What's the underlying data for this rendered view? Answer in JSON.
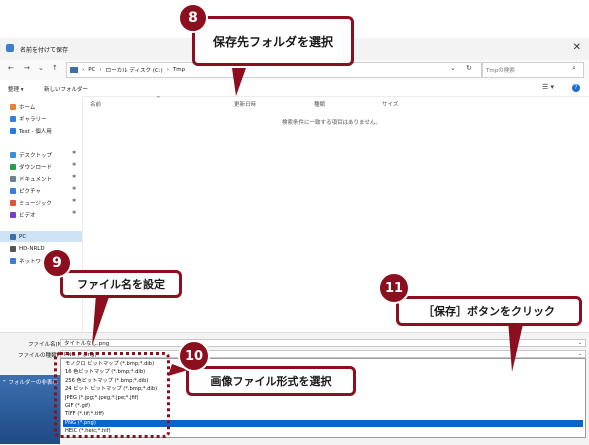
{
  "window": {
    "title": "名前を付けて保存"
  },
  "address": {
    "segments": [
      "PC",
      "ローカル ディスク (C:)",
      "Tmp"
    ],
    "search_placeholder": "Tmpの検索"
  },
  "toolbar": {
    "organize": "整理 ▾",
    "new_folder": "新しいフォルダー"
  },
  "sidebar": {
    "items": [
      {
        "label": "ホーム",
        "color": "#e5823a",
        "pinned": false
      },
      {
        "label": "ギャラリー",
        "color": "#3b7fd1",
        "pinned": false
      },
      {
        "label": "Test - 個人用",
        "color": "#2d7ad6",
        "pinned": false
      },
      {
        "label": "デスクトップ",
        "color": "#3b8fd8",
        "pinned": true
      },
      {
        "label": "ダウンロード",
        "color": "#2e9a4d",
        "pinned": true
      },
      {
        "label": "ドキュメント",
        "color": "#6b7f95",
        "pinned": true
      },
      {
        "label": "ピクチャ",
        "color": "#3a7fcf",
        "pinned": true
      },
      {
        "label": "ミュージック",
        "color": "#d8543a",
        "pinned": true
      },
      {
        "label": "ビデオ",
        "color": "#7a3fc4",
        "pinned": true
      },
      {
        "label": "PC",
        "color": "#3f6fa8",
        "pinned": false
      },
      {
        "label": "HD-NRLD",
        "color": "#555555",
        "pinned": false
      },
      {
        "label": "ネットワーク",
        "color": "#3a7fcf",
        "pinned": false
      }
    ]
  },
  "columns": [
    "名前",
    "更新日時",
    "種類",
    "サイズ"
  ],
  "empty_message": "検索条件に一致する項目はありません。",
  "bottom": {
    "filename_label": "ファイル名(N):",
    "filename_value": "タイトルなし.png",
    "filetype_label": "ファイルの種類(T):",
    "filetype_value": "PNG (*.png)",
    "folders_toggle": "フォルダーの非表示"
  },
  "file_types": [
    "モノクロ ビットマップ (*.bmp;*.dib)",
    "16 色ビットマップ (*.bmp;*.dib)",
    "256 色ビットマップ (*.bmp;*.dib)",
    "24 ビット ビットマップ (*.bmp;*.dib)",
    "JPEG (*.jpg;*.jpeg;*.jpe;*.jfif)",
    "GIF (*.gif)",
    "TIFF (*.tif;*.tiff)",
    "PNG (*.png)",
    "HEIC (*.heic;*.hif)"
  ],
  "selected_file_type_index": 7,
  "callouts": {
    "c8": {
      "num": "8",
      "text": "保存先フォルダを選択"
    },
    "c9": {
      "num": "9",
      "text": "ファイル名を設定"
    },
    "c10": {
      "num": "10",
      "text": "画像ファイル形式を選択"
    },
    "c11": {
      "num": "11",
      "text": "［保存］ボタンをクリック"
    }
  },
  "colors": {
    "callout": "#8b0f1e",
    "highlight": "#0a64c8"
  }
}
